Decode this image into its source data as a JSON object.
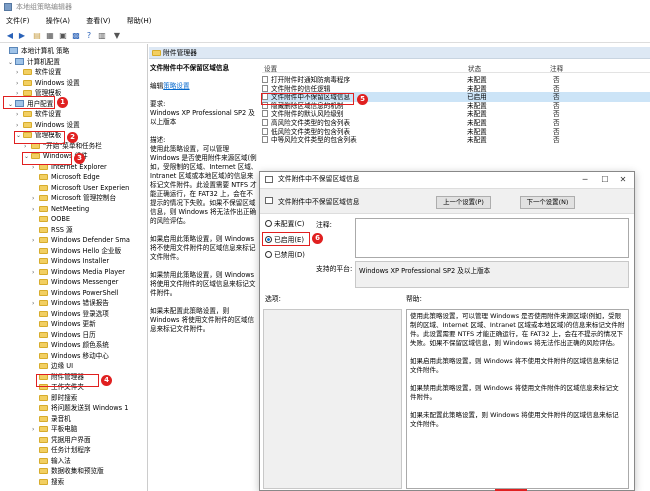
{
  "window": {
    "title": "本地组策略编辑器"
  },
  "menu": [
    "文件(F)",
    "操作(A)",
    "查看(V)",
    "帮助(H)"
  ],
  "tree": {
    "items": [
      {
        "label": "本地计算机 策略",
        "expander": "",
        "icon": "pc"
      },
      {
        "label": "计算机配置",
        "expander": "⌄",
        "icon": "pc"
      },
      {
        "label": "软件设置",
        "expander": "›",
        "icon": "folder"
      },
      {
        "label": "Windows 设置",
        "expander": "›",
        "icon": "folder"
      },
      {
        "label": "管理模板",
        "expander": "›",
        "icon": "folder"
      },
      {
        "label": "用户配置",
        "expander": "⌄",
        "icon": "pc"
      },
      {
        "label": "软件设置",
        "expander": "›",
        "icon": "folder"
      },
      {
        "label": "Windows 设置",
        "expander": "›",
        "icon": "folder"
      },
      {
        "label": "管理模板",
        "expander": "⌄",
        "icon": "folder"
      },
      {
        "label": "\"开始\"菜单和任务栏",
        "expander": "›",
        "icon": "folder"
      },
      {
        "label": "Windows 组件",
        "expander": "⌄",
        "icon": "folder"
      },
      {
        "label": "Internet Explorer",
        "expander": "›",
        "icon": "folder"
      },
      {
        "label": "Microsoft Edge",
        "expander": "",
        "icon": "folder"
      },
      {
        "label": "Microsoft User Experien",
        "expander": "",
        "icon": "folder"
      },
      {
        "label": "Microsoft 管理控制台",
        "expander": "›",
        "icon": "folder"
      },
      {
        "label": "NetMeeting",
        "expander": "›",
        "icon": "folder"
      },
      {
        "label": "OOBE",
        "expander": "",
        "icon": "folder"
      },
      {
        "label": "RSS 源",
        "expander": "",
        "icon": "folder"
      },
      {
        "label": "Windows Defender Sma",
        "expander": "›",
        "icon": "folder"
      },
      {
        "label": "Windows Hello 企业版",
        "expander": "",
        "icon": "folder"
      },
      {
        "label": "Windows Installer",
        "expander": "",
        "icon": "folder"
      },
      {
        "label": "Windows Media Player",
        "expander": "›",
        "icon": "folder"
      },
      {
        "label": "Windows Messenger",
        "expander": "",
        "icon": "folder"
      },
      {
        "label": "Windows PowerShell",
        "expander": "",
        "icon": "folder"
      },
      {
        "label": "Windows 错误报告",
        "expander": "›",
        "icon": "folder"
      },
      {
        "label": "Windows 登录选项",
        "expander": "",
        "icon": "folder"
      },
      {
        "label": "Windows 更新",
        "expander": "",
        "icon": "folder"
      },
      {
        "label": "Windows 日历",
        "expander": "",
        "icon": "folder"
      },
      {
        "label": "Windows 颜色系统",
        "expander": "",
        "icon": "folder"
      },
      {
        "label": "Windows 移动中心",
        "expander": "",
        "icon": "folder"
      },
      {
        "label": "边缘 UI",
        "expander": "",
        "icon": "folder"
      },
      {
        "label": "附件管理器",
        "expander": "",
        "icon": "folder"
      },
      {
        "label": "工作文件夹",
        "expander": "",
        "icon": "folder"
      },
      {
        "label": "即时搜索",
        "expander": "",
        "icon": "folder"
      },
      {
        "label": "将问题发送到 Windows 1",
        "expander": "",
        "icon": "folder"
      },
      {
        "label": "录音机",
        "expander": "",
        "icon": "folder"
      },
      {
        "label": "平板电脑",
        "expander": "›",
        "icon": "folder"
      },
      {
        "label": "凭据用户界面",
        "expander": "",
        "icon": "folder"
      },
      {
        "label": "任务计划程序",
        "expander": "",
        "icon": "folder"
      },
      {
        "label": "输入法",
        "expander": "",
        "icon": "folder"
      },
      {
        "label": "数据收集和预览版",
        "expander": "",
        "icon": "folder"
      },
      {
        "label": "搜索",
        "expander": "",
        "icon": "folder"
      }
    ]
  },
  "badges": [
    "1",
    "2",
    "3",
    "4",
    "5",
    "6"
  ],
  "right": {
    "header": "附件管理器",
    "policy_title": "文件附件中不保留区域信息",
    "edit_prefix": "编辑",
    "edit_link": "策略设置",
    "requirements_label": "要求:",
    "requirements": "Windows XP Professional SP2 及以上版本",
    "description_label": "描述:",
    "description": "使用此策略设置，可以管理 Windows 是否使用附件来源区域(例如，受限制的区域、Internet 区域、Intranet 区域或本地区域)的信息来标记文件附件。此设置需要 NTFS 才能正确运行，在 FAT32 上，会在不提示的情况下失败。如果不保留区域信息，则 Windows 将无法作出正确的风险评估。",
    "desc_enabled": "如果启用此策略设置，则 Windows 将不使用文件附件的区域信息来标记文件附件。",
    "desc_disabled": "如果禁用此策略设置，则 Windows 将使用文件附件的区域信息来标记文件附件。",
    "desc_notconfigured": "如果未配置此策略设置，则 Windows 将使用文件附件的区域信息来标记文件附件。",
    "columns": {
      "setting": "设置",
      "state": "状态",
      "note": "注释"
    },
    "rows": [
      {
        "name": "打开附件时通知防病毒程序",
        "state": "未配置",
        "note": "否"
      },
      {
        "name": "文件附件的信任逻辑",
        "state": "未配置",
        "note": "否"
      },
      {
        "name": "文件附件中不保留区域信息",
        "state": "已启用",
        "note": "否"
      },
      {
        "name": "隐藏删除区域信息的机制",
        "state": "未配置",
        "note": "否"
      },
      {
        "name": "文件附件的默认风险级别",
        "state": "未配置",
        "note": "否"
      },
      {
        "name": "高风险文件类型的包含列表",
        "state": "未配置",
        "note": "否"
      },
      {
        "name": "低风险文件类型的包含列表",
        "state": "未配置",
        "note": "否"
      },
      {
        "name": "中等风险文件类型的包含列表",
        "state": "未配置",
        "note": "否"
      }
    ]
  },
  "dialog": {
    "title": "文件附件中不保留区域信息",
    "subtitle": "文件附件中不保留区域信息",
    "prev": "上一个设置(P)",
    "next": "下一个设置(N)",
    "radio_notconfigured": "未配置(C)",
    "radio_enabled": "已启用(E)",
    "radio_disabled": "已禁用(D)",
    "comment_label": "注释:",
    "supported_label": "支持的平台:",
    "supported_value": "Windows XP Professional SP2 及以上版本",
    "options_label": "选项:",
    "help_label": "帮助:",
    "help_p1": "使用此策略设置，可以管理 Windows 是否使用附件来源区域(例如，受限制的区域、Internet 区域、Intranet 区域或本地区域)的信息来标记文件附件。此设置需要 NTFS 才能正确运行，在 FAT32 上，会在不提示的情况下失败。如果不保留区域信息，则 Windows 将无法作出正确的风险评估。",
    "help_p2": "如果启用此策略设置，则 Windows 将不使用文件附件的区域信息来标记文件附件。",
    "help_p3": "如果禁用此策略设置，则 Windows 将使用文件附件的区域信息来标记文件附件。",
    "help_p4": "如果未配置此策略设置，则 Windows 将使用文件附件的区域信息来标记文件附件。",
    "selected": "enabled"
  },
  "colors": {
    "highlight": "#e02020",
    "selection": "#cce4f7",
    "link": "#0066cc"
  }
}
